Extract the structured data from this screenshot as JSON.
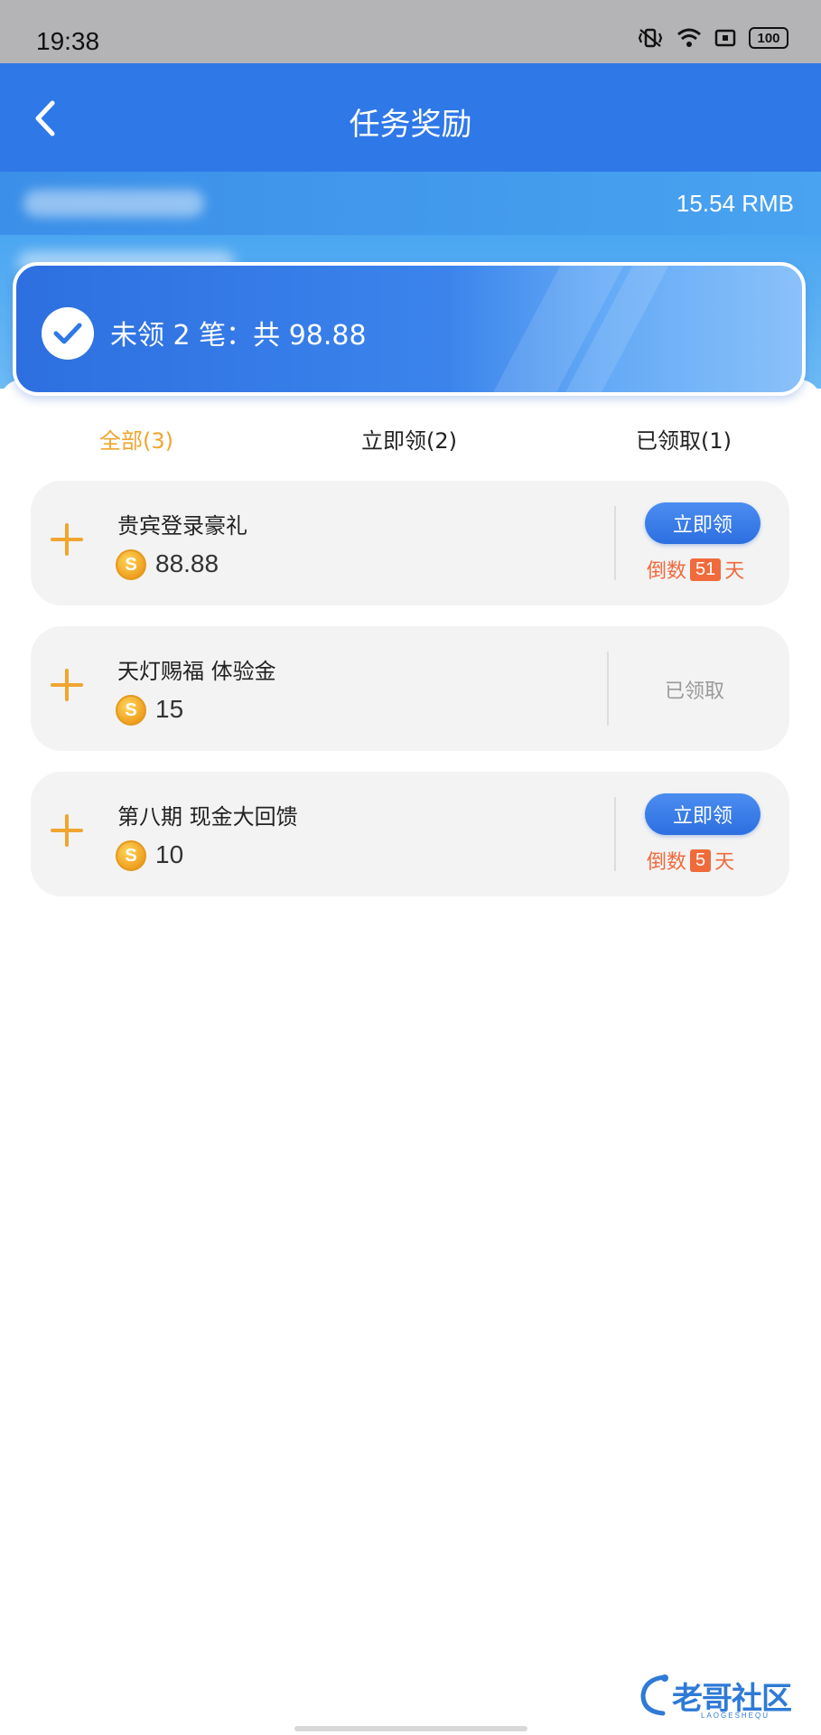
{
  "status_bar": {
    "time": "19:38",
    "battery": "100"
  },
  "header": {
    "title": "任务奖励"
  },
  "balance": {
    "value": "15.54 RMB"
  },
  "summary": {
    "text": "未领 2 笔：共 98.88"
  },
  "tabs": [
    {
      "label": "全部(3)",
      "active": true
    },
    {
      "label": "立即领(2)",
      "active": false
    },
    {
      "label": "已领取(1)",
      "active": false
    }
  ],
  "rewards": [
    {
      "name": "贵宾登录豪礼",
      "amount": "88.88",
      "status": "claimable",
      "button_label": "立即领",
      "countdown_prefix": "倒数",
      "days": "51",
      "countdown_suffix": "天"
    },
    {
      "name": "天灯赐福 体验金",
      "amount": "15",
      "status": "claimed",
      "claimed_label": "已领取"
    },
    {
      "name": "第八期 现金大回馈",
      "amount": "10",
      "status": "claimable",
      "button_label": "立即领",
      "countdown_prefix": "倒数",
      "days": "5",
      "countdown_suffix": "天"
    }
  ],
  "coin_symbol": "S",
  "watermark": {
    "text": "老哥社区",
    "subtext": "LAOGESHEQU"
  },
  "colors": {
    "header_blue": "#2f78e8",
    "accent_orange": "#f0a530",
    "countdown_red": "#f06a3c",
    "claimed_gray": "#9a9a9a"
  }
}
